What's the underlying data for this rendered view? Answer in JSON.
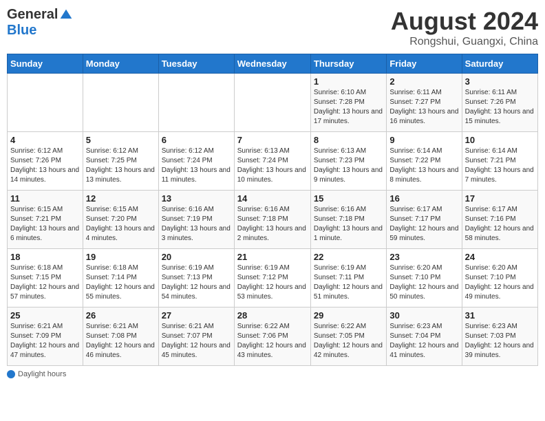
{
  "logo": {
    "general": "General",
    "blue": "Blue"
  },
  "title": "August 2024",
  "subtitle": "Rongshui, Guangxi, China",
  "days_of_week": [
    "Sunday",
    "Monday",
    "Tuesday",
    "Wednesday",
    "Thursday",
    "Friday",
    "Saturday"
  ],
  "footer": {
    "label": "Daylight hours"
  },
  "weeks": [
    [
      {
        "num": "",
        "info": ""
      },
      {
        "num": "",
        "info": ""
      },
      {
        "num": "",
        "info": ""
      },
      {
        "num": "",
        "info": ""
      },
      {
        "num": "1",
        "info": "Sunrise: 6:10 AM\nSunset: 7:28 PM\nDaylight: 13 hours and 17 minutes."
      },
      {
        "num": "2",
        "info": "Sunrise: 6:11 AM\nSunset: 7:27 PM\nDaylight: 13 hours and 16 minutes."
      },
      {
        "num": "3",
        "info": "Sunrise: 6:11 AM\nSunset: 7:26 PM\nDaylight: 13 hours and 15 minutes."
      }
    ],
    [
      {
        "num": "4",
        "info": "Sunrise: 6:12 AM\nSunset: 7:26 PM\nDaylight: 13 hours and 14 minutes."
      },
      {
        "num": "5",
        "info": "Sunrise: 6:12 AM\nSunset: 7:25 PM\nDaylight: 13 hours and 13 minutes."
      },
      {
        "num": "6",
        "info": "Sunrise: 6:12 AM\nSunset: 7:24 PM\nDaylight: 13 hours and 11 minutes."
      },
      {
        "num": "7",
        "info": "Sunrise: 6:13 AM\nSunset: 7:24 PM\nDaylight: 13 hours and 10 minutes."
      },
      {
        "num": "8",
        "info": "Sunrise: 6:13 AM\nSunset: 7:23 PM\nDaylight: 13 hours and 9 minutes."
      },
      {
        "num": "9",
        "info": "Sunrise: 6:14 AM\nSunset: 7:22 PM\nDaylight: 13 hours and 8 minutes."
      },
      {
        "num": "10",
        "info": "Sunrise: 6:14 AM\nSunset: 7:21 PM\nDaylight: 13 hours and 7 minutes."
      }
    ],
    [
      {
        "num": "11",
        "info": "Sunrise: 6:15 AM\nSunset: 7:21 PM\nDaylight: 13 hours and 6 minutes."
      },
      {
        "num": "12",
        "info": "Sunrise: 6:15 AM\nSunset: 7:20 PM\nDaylight: 13 hours and 4 minutes."
      },
      {
        "num": "13",
        "info": "Sunrise: 6:16 AM\nSunset: 7:19 PM\nDaylight: 13 hours and 3 minutes."
      },
      {
        "num": "14",
        "info": "Sunrise: 6:16 AM\nSunset: 7:18 PM\nDaylight: 13 hours and 2 minutes."
      },
      {
        "num": "15",
        "info": "Sunrise: 6:16 AM\nSunset: 7:18 PM\nDaylight: 13 hours and 1 minute."
      },
      {
        "num": "16",
        "info": "Sunrise: 6:17 AM\nSunset: 7:17 PM\nDaylight: 12 hours and 59 minutes."
      },
      {
        "num": "17",
        "info": "Sunrise: 6:17 AM\nSunset: 7:16 PM\nDaylight: 12 hours and 58 minutes."
      }
    ],
    [
      {
        "num": "18",
        "info": "Sunrise: 6:18 AM\nSunset: 7:15 PM\nDaylight: 12 hours and 57 minutes."
      },
      {
        "num": "19",
        "info": "Sunrise: 6:18 AM\nSunset: 7:14 PM\nDaylight: 12 hours and 55 minutes."
      },
      {
        "num": "20",
        "info": "Sunrise: 6:19 AM\nSunset: 7:13 PM\nDaylight: 12 hours and 54 minutes."
      },
      {
        "num": "21",
        "info": "Sunrise: 6:19 AM\nSunset: 7:12 PM\nDaylight: 12 hours and 53 minutes."
      },
      {
        "num": "22",
        "info": "Sunrise: 6:19 AM\nSunset: 7:11 PM\nDaylight: 12 hours and 51 minutes."
      },
      {
        "num": "23",
        "info": "Sunrise: 6:20 AM\nSunset: 7:10 PM\nDaylight: 12 hours and 50 minutes."
      },
      {
        "num": "24",
        "info": "Sunrise: 6:20 AM\nSunset: 7:10 PM\nDaylight: 12 hours and 49 minutes."
      }
    ],
    [
      {
        "num": "25",
        "info": "Sunrise: 6:21 AM\nSunset: 7:09 PM\nDaylight: 12 hours and 47 minutes."
      },
      {
        "num": "26",
        "info": "Sunrise: 6:21 AM\nSunset: 7:08 PM\nDaylight: 12 hours and 46 minutes."
      },
      {
        "num": "27",
        "info": "Sunrise: 6:21 AM\nSunset: 7:07 PM\nDaylight: 12 hours and 45 minutes."
      },
      {
        "num": "28",
        "info": "Sunrise: 6:22 AM\nSunset: 7:06 PM\nDaylight: 12 hours and 43 minutes."
      },
      {
        "num": "29",
        "info": "Sunrise: 6:22 AM\nSunset: 7:05 PM\nDaylight: 12 hours and 42 minutes."
      },
      {
        "num": "30",
        "info": "Sunrise: 6:23 AM\nSunset: 7:04 PM\nDaylight: 12 hours and 41 minutes."
      },
      {
        "num": "31",
        "info": "Sunrise: 6:23 AM\nSunset: 7:03 PM\nDaylight: 12 hours and 39 minutes."
      }
    ]
  ]
}
